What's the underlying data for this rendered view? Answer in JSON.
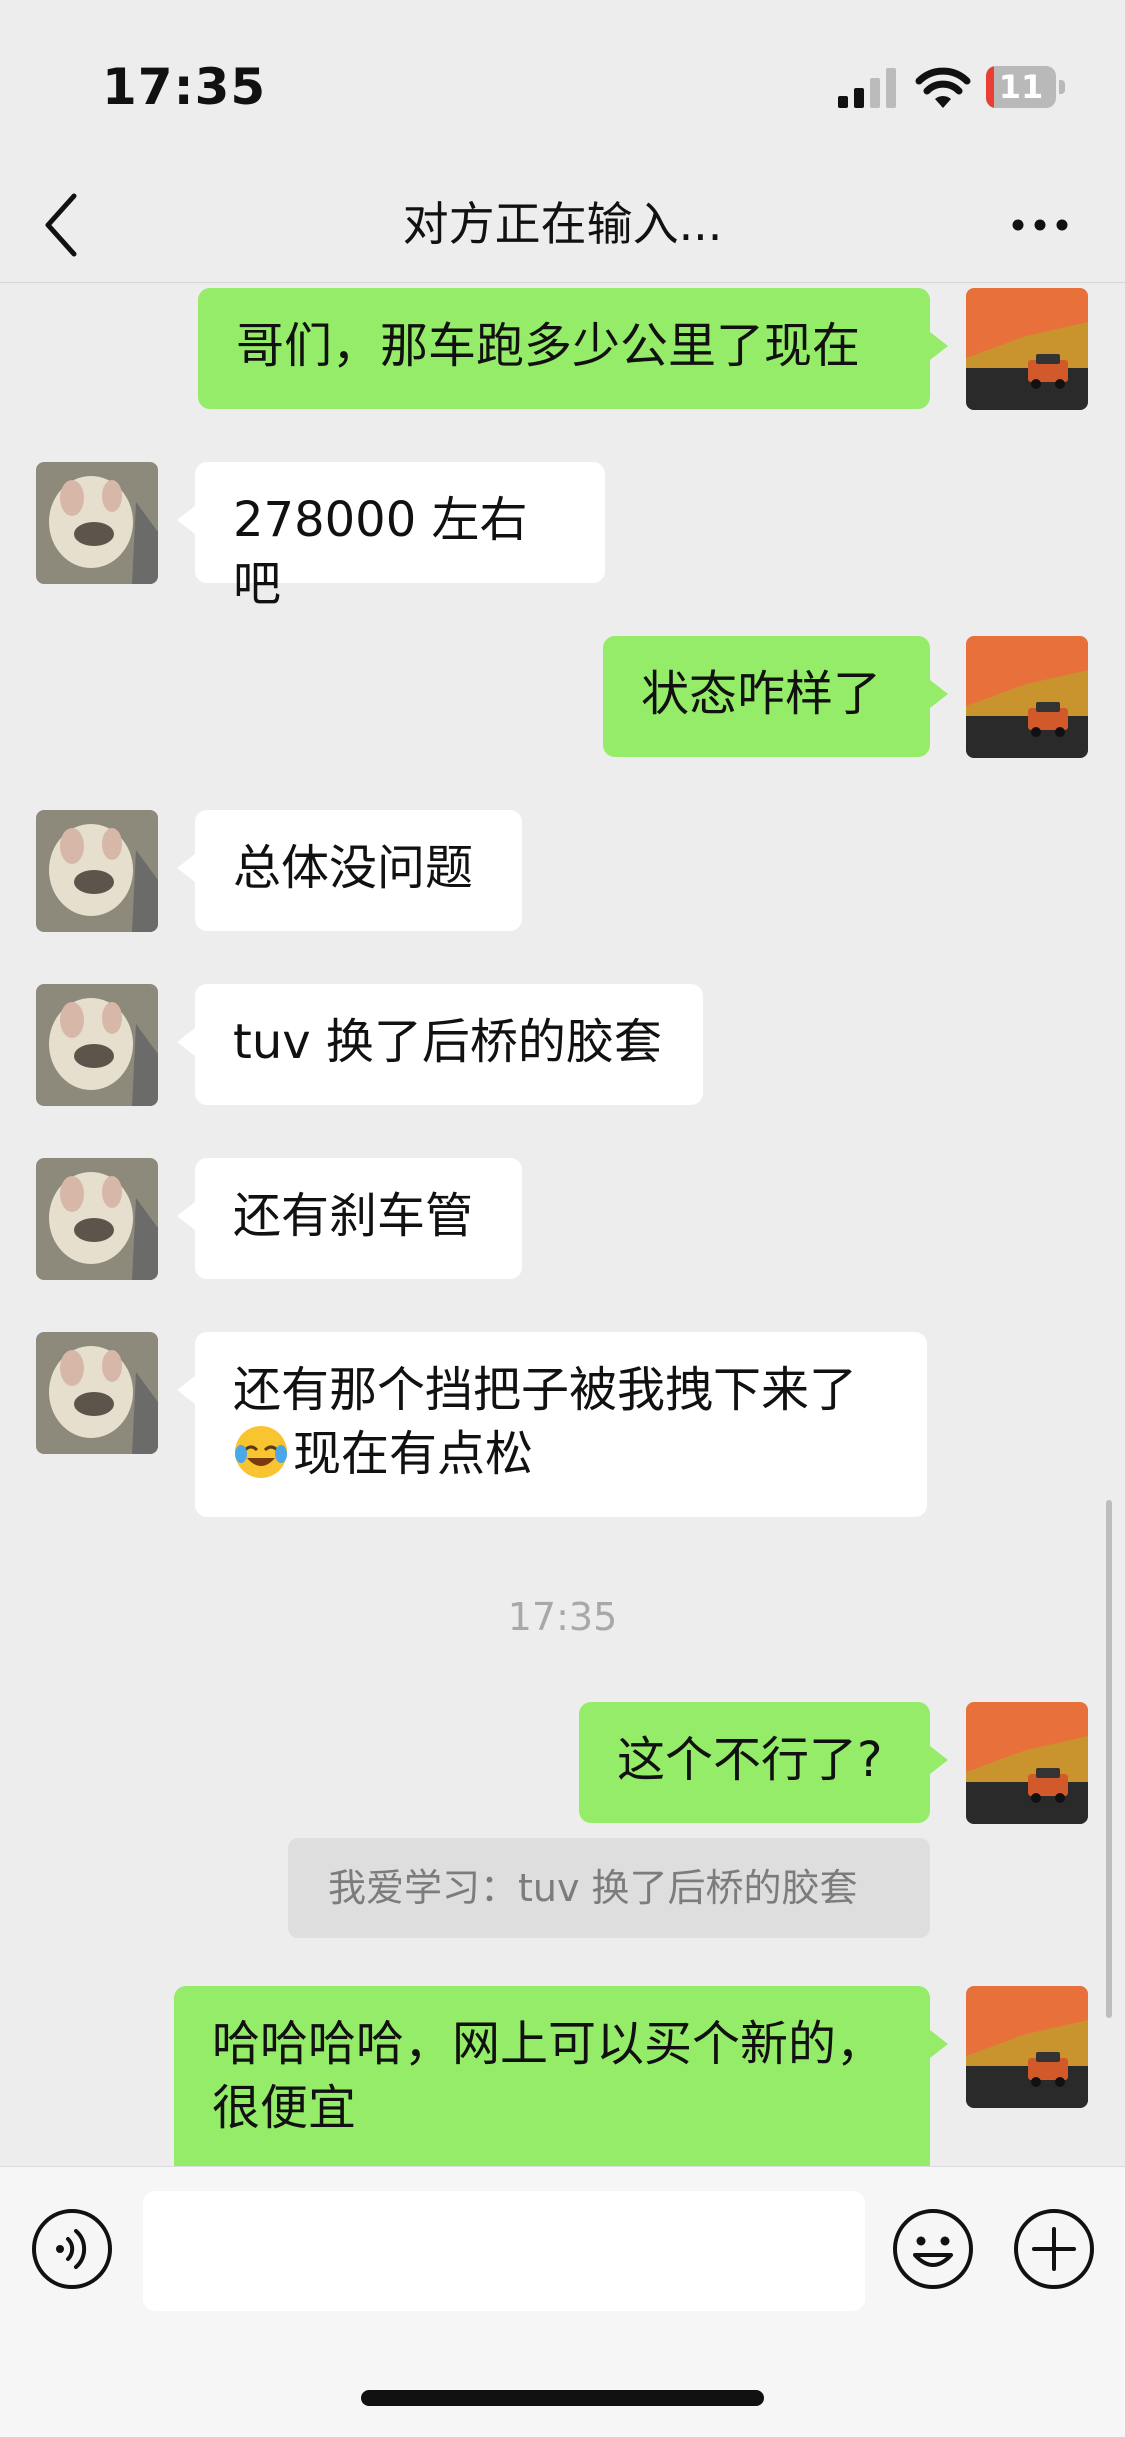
{
  "status_bar": {
    "time": "17:35",
    "battery_level": "11",
    "battery_fraction": 0.11
  },
  "nav": {
    "title": "对方正在输入..."
  },
  "messages": [
    {
      "sender": "self",
      "text": "哥们，那车跑多少公里了现在"
    },
    {
      "sender": "friend",
      "text": "278000 左右吧"
    },
    {
      "sender": "self",
      "text": "状态咋样了"
    },
    {
      "sender": "friend",
      "text": "总体没问题"
    },
    {
      "sender": "friend",
      "text": "tuv 换了后桥的胶套"
    },
    {
      "sender": "friend",
      "text": "还有刹车管"
    },
    {
      "sender": "friend",
      "line1": "还有那个挡把子被我拽下来了",
      "line2": "现在有点松",
      "emoji": "grinning-squinting-face-with-tears"
    },
    {
      "sender": "self",
      "text": "这个不行了?"
    },
    {
      "sender": "self",
      "line1": "哈哈哈哈，网上可以买个新的，",
      "line2": "很便宜"
    }
  ],
  "timestamp": "17:35",
  "quote": {
    "text": "我爱学习：tuv 换了后桥的胶套"
  },
  "icons": {
    "back": "chevron-left-icon",
    "more": "more-dots-icon",
    "voice": "voice-icon",
    "emoji": "emoji-icon",
    "plus": "plus-icon"
  },
  "colors": {
    "self_bubble": "#95ec69",
    "friend_bubble": "#ffffff",
    "background": "#ededed"
  }
}
